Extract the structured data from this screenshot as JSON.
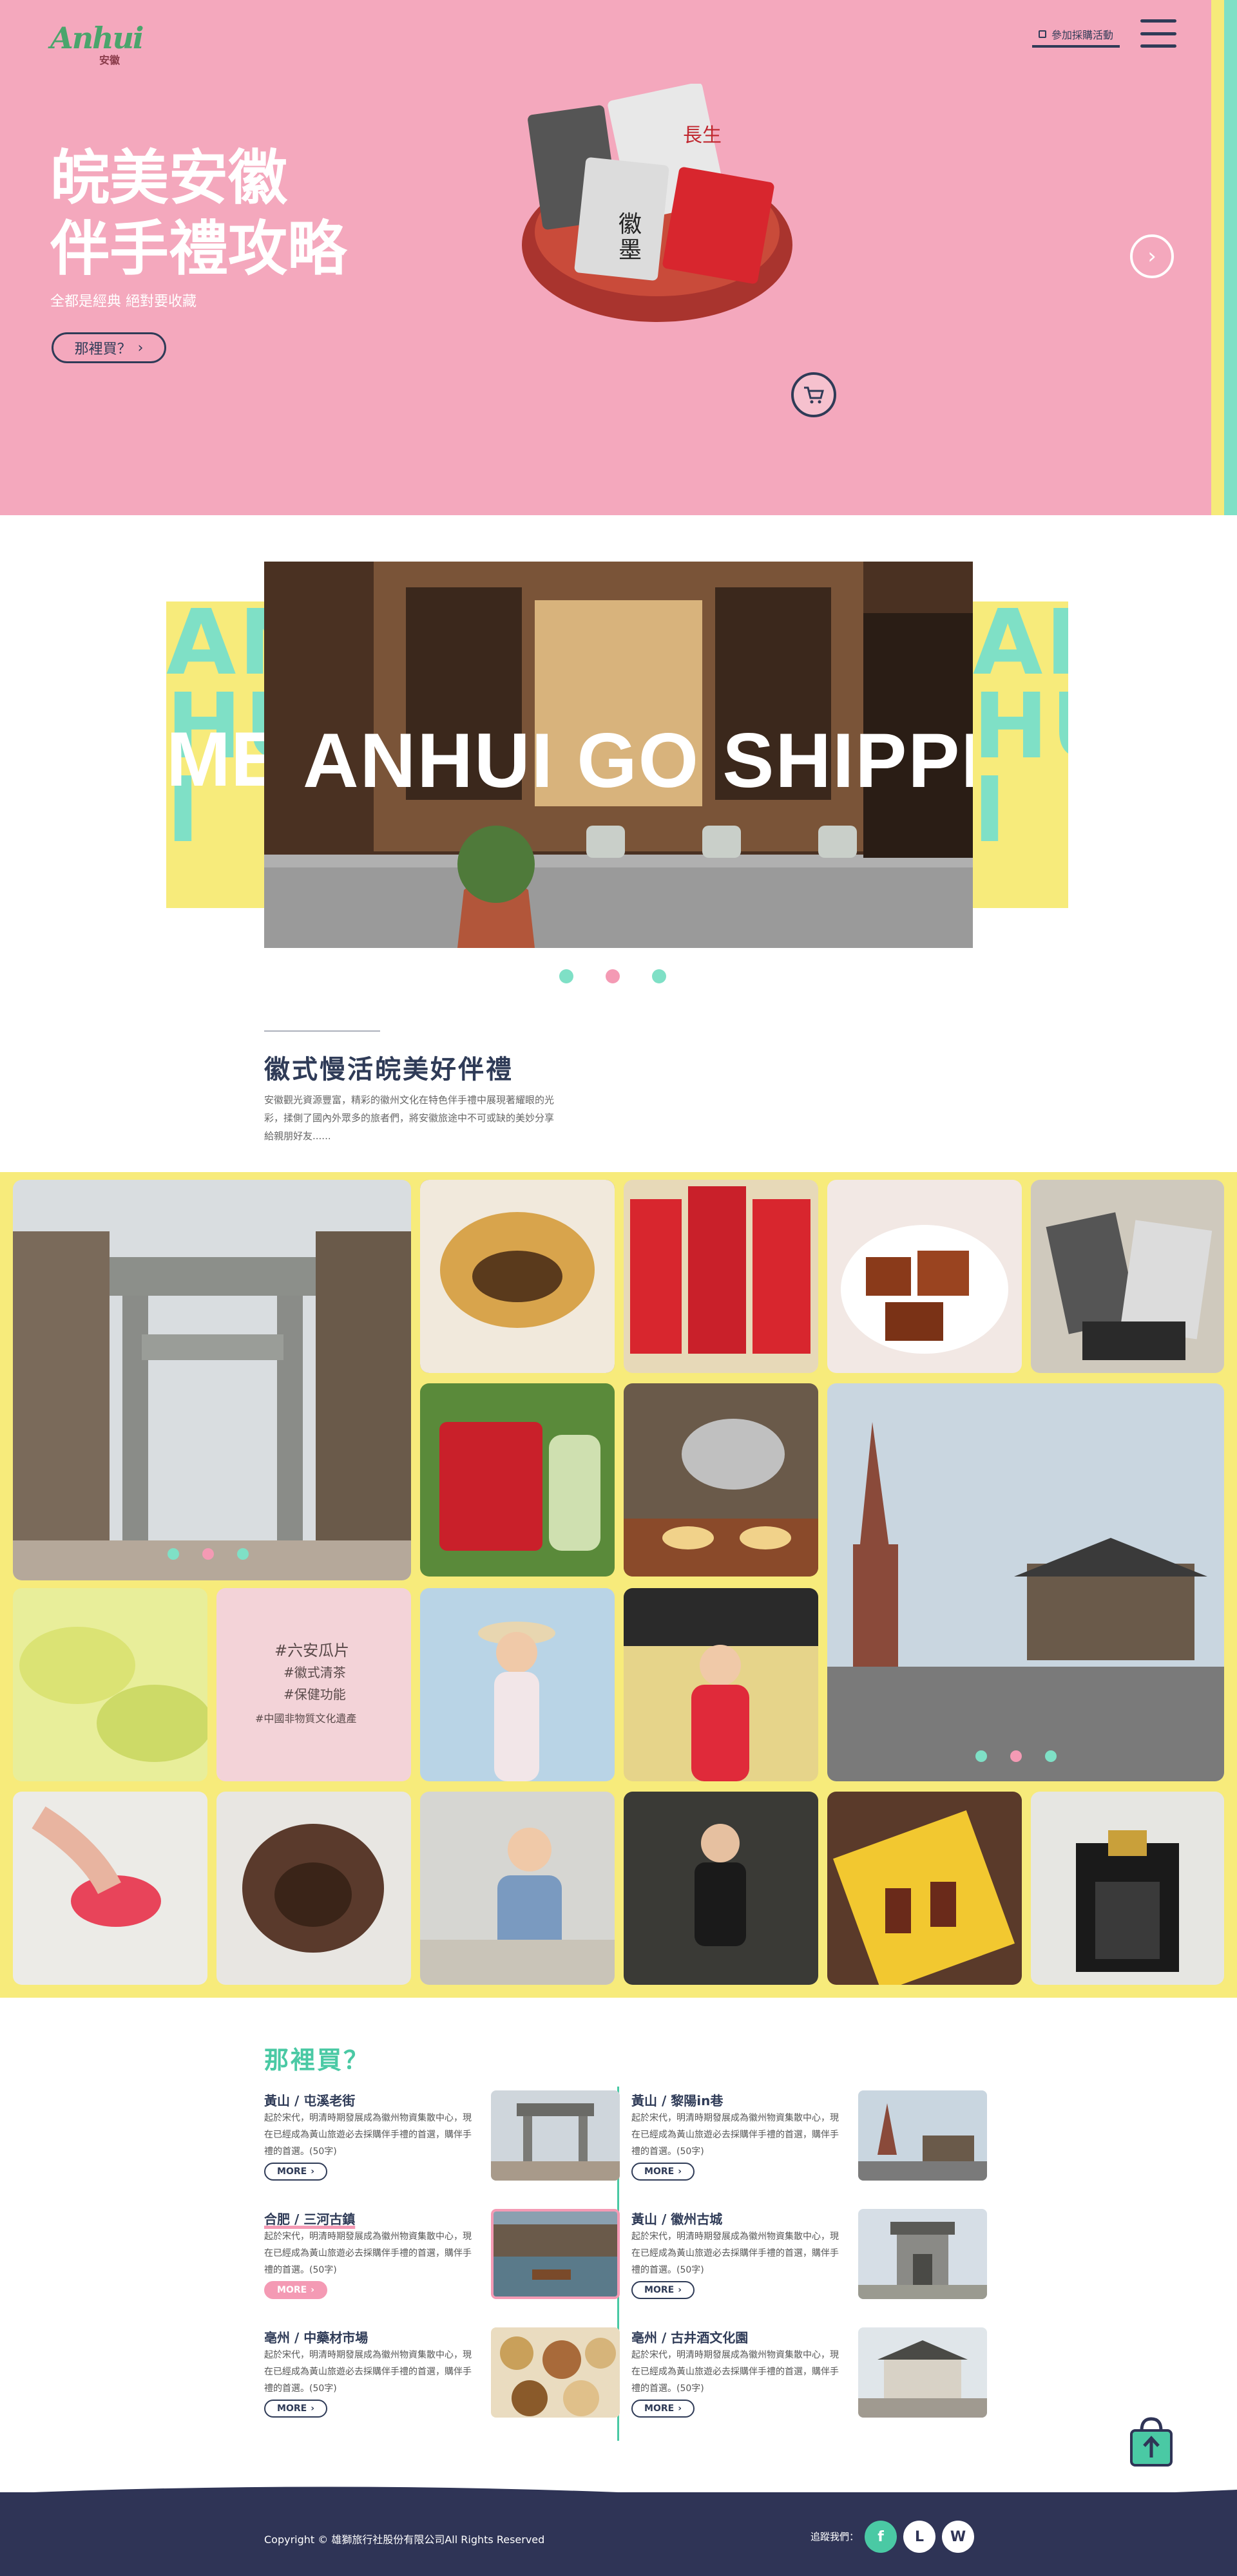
{
  "header": {
    "logo_text": "Anhui",
    "logo_sub": "安徽",
    "join_label": "參加採購活動",
    "menu_icon": "hamburger-icon"
  },
  "hero": {
    "title_line1": "皖美安徽",
    "title_line2": "伴手禮攻略",
    "subtitle": "全都是經典 絕對要收藏",
    "button_label": "那裡買？",
    "next_icon": "chevron-right-icon",
    "cart_icon": "cart-icon"
  },
  "banner": {
    "text": "ANHUI GO SHIPPING",
    "left_fragment": "ME",
    "side_letters": "AN\nHU\nI",
    "dots": [
      "#7fe0c6",
      "#f49ab4",
      "#7fe0c6"
    ]
  },
  "intro": {
    "title": "徽式慢活皖美好伴禮",
    "text": "安徽觀光資源豐富，精彩的徽州文化在特色伴手禮中展現著耀眼的光彩，揉側了國內外眾多的旅者們，將安徽旅途中不可或缺的美妙分享給親朋好友......"
  },
  "gallery": {
    "tag_lines": [
      "#六安瓜片",
      "#徽式清茶",
      "#保健功能",
      "#中國非物質文化遺產"
    ],
    "slider_dots": [
      "#7fe0c6",
      "#f49ab4",
      "#7fe0c6"
    ]
  },
  "where": {
    "title": "那裡買？",
    "more_label": "MORE",
    "shops": [
      {
        "name": "黃山 / 屯溪老街",
        "desc": "起於宋代，明清時期發展成為徽州物資集散中心，現在已經成為黃山旅遊必去採購伴手禮的首選，購伴手禮的首選。(50字)"
      },
      {
        "name": "黃山 / 黎陽in巷",
        "desc": "起於宋代，明清時期發展成為徽州物資集散中心，現在已經成為黃山旅遊必去採購伴手禮的首選，購伴手禮的首選。(50字)"
      },
      {
        "name": "合肥 / 三河古鎮",
        "desc": "起於宋代，明清時期發展成為徽州物資集散中心，現在已經成為黃山旅遊必去採購伴手禮的首選，購伴手禮的首選。(50字)"
      },
      {
        "name": "黃山 / 徽州古城",
        "desc": "起於宋代，明清時期發展成為徽州物資集散中心，現在已經成為黃山旅遊必去採購伴手禮的首選，購伴手禮的首選。(50字)"
      },
      {
        "name": "亳州 / 中藥材市場",
        "desc": "起於宋代，明清時期發展成為徽州物資集散中心，現在已經成為黃山旅遊必去採購伴手禮的首選，購伴手禮的首選。(50字)"
      },
      {
        "name": "亳州 / 古井酒文化園",
        "desc": "起於宋代，明清時期發展成為徽州物資集散中心，現在已經成為黃山旅遊必去採購伴手禮的首選，購伴手禮的首選。(50字)"
      }
    ]
  },
  "footer": {
    "copyright": "Copyright © 雄獅旅行社股份有限公司All Rights Reserved",
    "follow_label": "追蹤我們：",
    "social": [
      {
        "icon": "facebook-icon",
        "glyph": "f",
        "bg": "#4ac9a4",
        "fg": "#ffffff"
      },
      {
        "icon": "line-icon",
        "glyph": "L",
        "bg": "#ffffff",
        "fg": "#2f3456"
      },
      {
        "icon": "weibo-icon",
        "glyph": "W",
        "bg": "#ffffff",
        "fg": "#2f3456"
      }
    ]
  },
  "colors": {
    "hero_bg": "#f4a8bd",
    "accent_teal": "#4ac9a4",
    "accent_pink": "#f49ab4",
    "gallery_bg": "#f7eb7b",
    "navy": "#2f3456"
  }
}
